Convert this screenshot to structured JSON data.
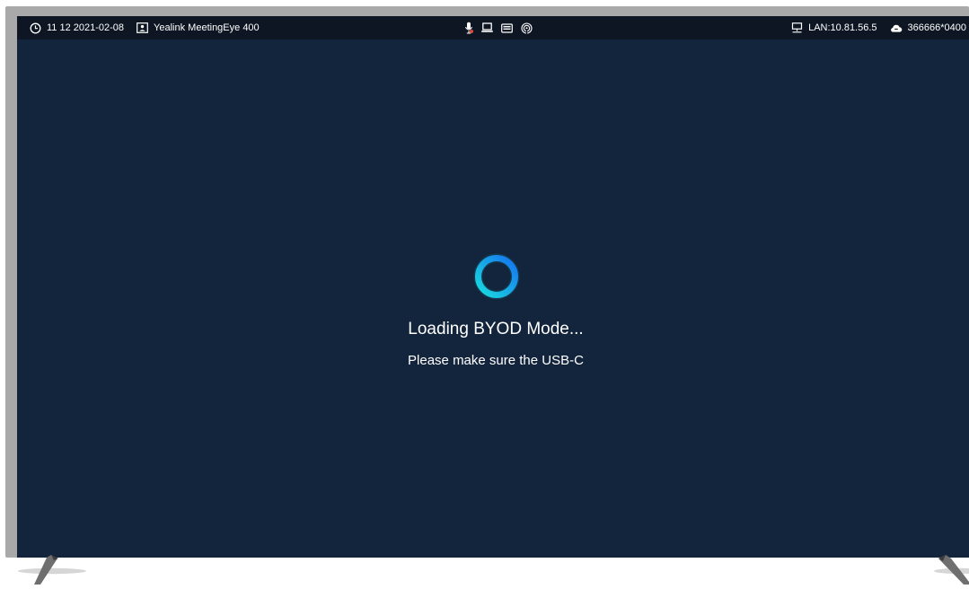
{
  "status_bar": {
    "time": "11 12 2021-02-08",
    "device_name": "Yealink MeetingEye 400",
    "lan": "LAN:10.81.56.5",
    "account": "366666*0400",
    "icons": [
      "clock-icon",
      "display-icon",
      "microphone-icon",
      "laptop-icon",
      "keyboard-icon",
      "wireless-icon",
      "network-icon",
      "cloud-icon"
    ]
  },
  "loading": {
    "title": "Loading BYOD Mode...",
    "message": "Please make sure the USB-C"
  },
  "colors": {
    "screen_bg": "#13243d",
    "status_bg": "#0d1622",
    "spinner_start": "#19dde0",
    "spinner_end": "#1673f0",
    "frame": "#a9a9a9"
  }
}
